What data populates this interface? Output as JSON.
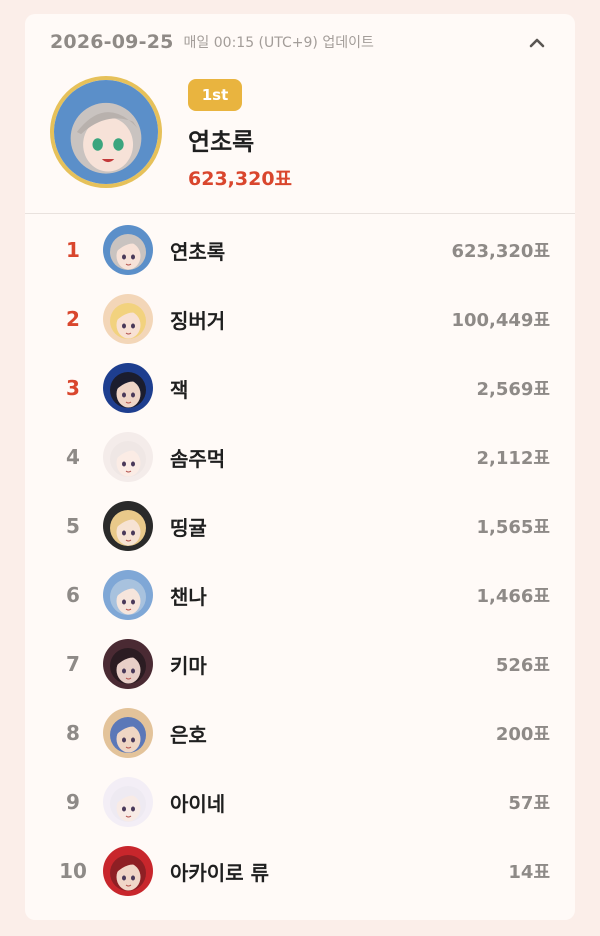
{
  "header": {
    "date": "2026-09-25",
    "update_text": "매일 00:15 (UTC+9) 업데이트"
  },
  "top": {
    "badge": "1st",
    "name": "연초록",
    "votes": "623,320표"
  },
  "ranking": [
    {
      "rank": "1",
      "name": "연초록",
      "votes": "623,320표",
      "hair": "#c9c3c0",
      "bg": "#5b8fc9",
      "skin": "#f7e2d8"
    },
    {
      "rank": "2",
      "name": "징버거",
      "votes": "100,449표",
      "hair": "#f2d27e",
      "bg": "#f3d6b8",
      "skin": "#f8e1d4"
    },
    {
      "rank": "3",
      "name": "잭",
      "votes": "2,569표",
      "hair": "#1b1d2e",
      "bg": "#1e3e8f",
      "skin": "#eed5c7"
    },
    {
      "rank": "4",
      "name": "솜주먹",
      "votes": "2,112표",
      "hair": "#efe7e5",
      "bg": "#f4ecea",
      "skin": "#fbece5"
    },
    {
      "rank": "5",
      "name": "띵귤",
      "votes": "1,565표",
      "hair": "#e9c98a",
      "bg": "#2a2a2a",
      "skin": "#f7e3d3"
    },
    {
      "rank": "6",
      "name": "챈나",
      "votes": "1,466표",
      "hair": "#a8c2de",
      "bg": "#7fa7d6",
      "skin": "#f6e5dc"
    },
    {
      "rank": "7",
      "name": "키마",
      "votes": "526표",
      "hair": "#2b1c22",
      "bg": "#4a2a33",
      "skin": "#e8cfc8"
    },
    {
      "rank": "8",
      "name": "은호",
      "votes": "200표",
      "hair": "#5b78b8",
      "bg": "#e3c39a",
      "skin": "#efd6c4"
    },
    {
      "rank": "9",
      "name": "아이네",
      "votes": "57표",
      "hair": "#eeeaf2",
      "bg": "#f3eef6",
      "skin": "#f8ebe6"
    },
    {
      "rank": "10",
      "name": "아카이로 류",
      "votes": "14표",
      "hair": "#8e1f24",
      "bg": "#c8262c",
      "skin": "#f0d6c8"
    }
  ],
  "icons": {
    "collapse": "chevron-up-icon"
  },
  "colors": {
    "accent_red": "#d9462d",
    "badge_gold": "#e9b43f",
    "muted": "#8e8a87"
  }
}
